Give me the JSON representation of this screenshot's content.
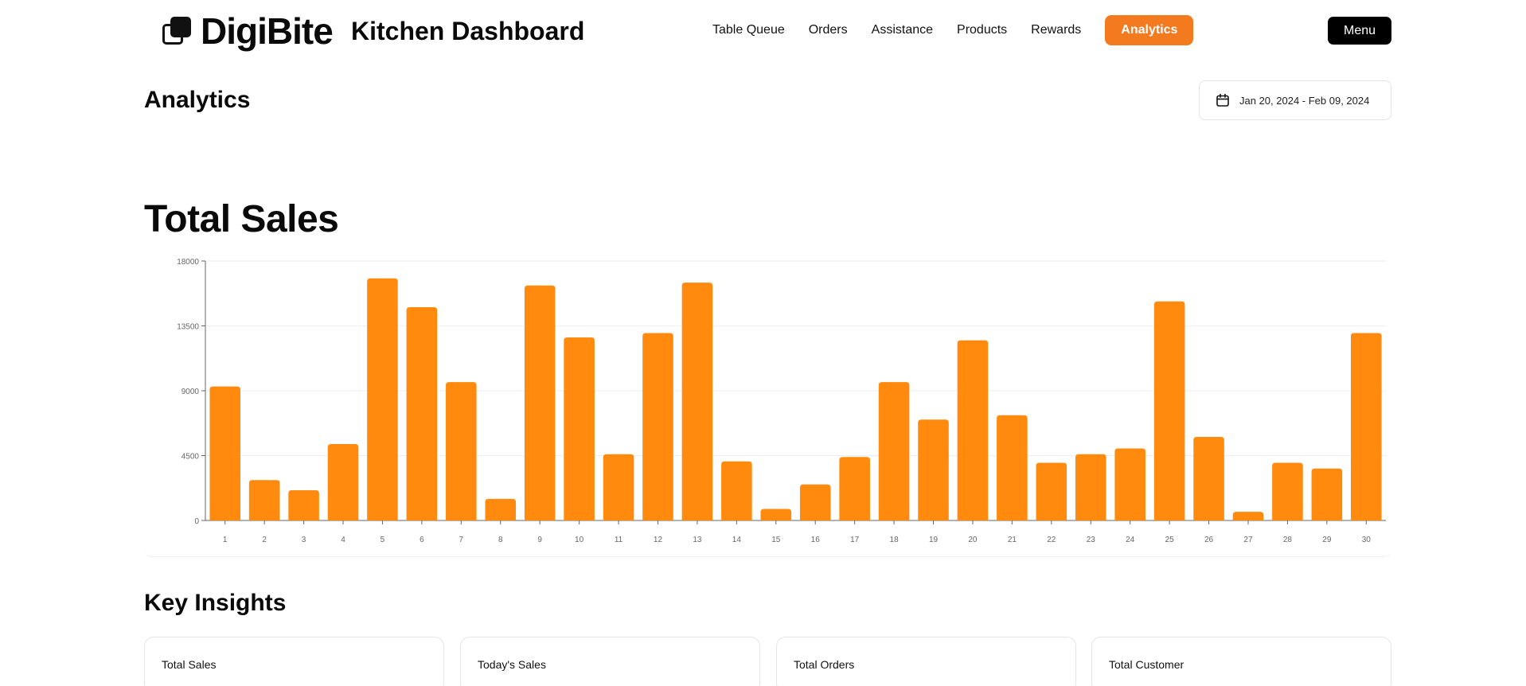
{
  "header": {
    "brand": "DigiBite",
    "title": "Kitchen Dashboard",
    "nav": [
      {
        "label": "Table Queue"
      },
      {
        "label": "Orders"
      },
      {
        "label": "Assistance"
      },
      {
        "label": "Products"
      },
      {
        "label": "Rewards"
      },
      {
        "label": "Analytics"
      }
    ],
    "menu_label": "Menu"
  },
  "page": {
    "title": "Analytics",
    "date_range": "Jan 20, 2024 - Feb 09, 2024"
  },
  "sales": {
    "title": "Total Sales"
  },
  "insights": {
    "title": "Key Insights",
    "cards": [
      {
        "label": "Total Sales"
      },
      {
        "label": "Today's Sales"
      },
      {
        "label": "Total Orders"
      },
      {
        "label": "Total Customer"
      }
    ]
  },
  "colors": {
    "accent": "#f47a1f",
    "bar": "#ff8a0d"
  },
  "chart_data": {
    "type": "bar",
    "categories": [
      "1",
      "2",
      "3",
      "4",
      "5",
      "6",
      "7",
      "8",
      "9",
      "10",
      "11",
      "12",
      "13",
      "14",
      "15",
      "16",
      "17",
      "18",
      "19",
      "20",
      "21",
      "22",
      "23",
      "24",
      "25",
      "26",
      "27",
      "28",
      "29",
      "30"
    ],
    "values": [
      9300,
      2800,
      2100,
      5300,
      16800,
      14800,
      9600,
      1500,
      16300,
      12700,
      4600,
      13000,
      16500,
      4100,
      800,
      2500,
      4400,
      9600,
      7000,
      12500,
      7300,
      4000,
      4600,
      5000,
      15200,
      5800,
      600,
      4000,
      3600,
      13000
    ],
    "yticks": [
      0,
      4500,
      9000,
      13500,
      18000
    ],
    "ylim": [
      0,
      18000
    ],
    "grid": true
  }
}
